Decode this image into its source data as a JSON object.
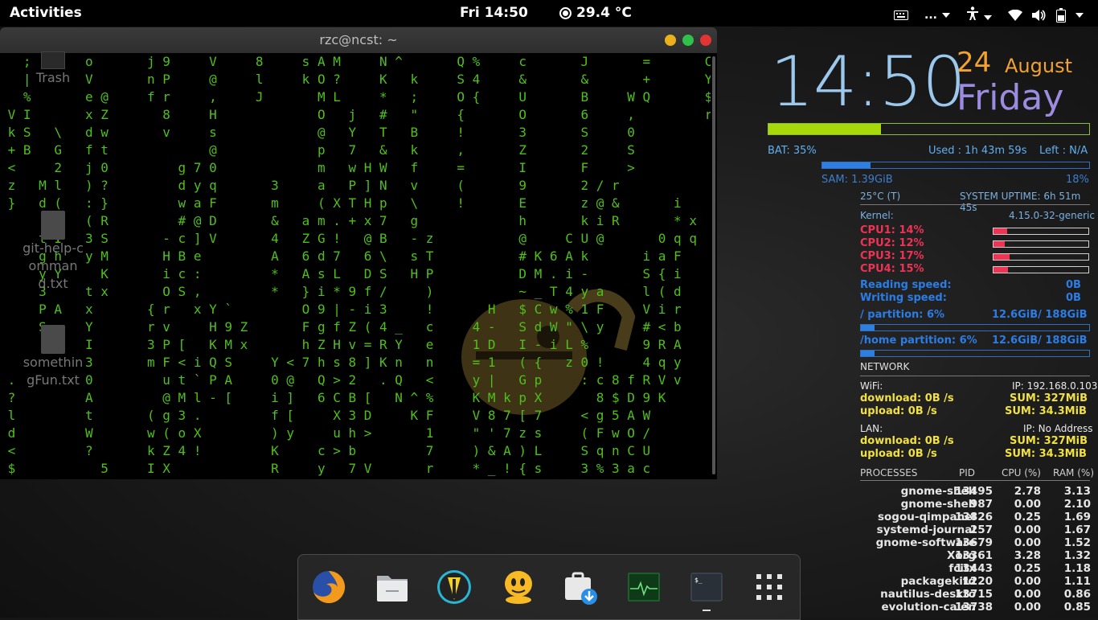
{
  "topbar": {
    "activities": "Activities",
    "clock": "Fri 14:50",
    "weather": "29.4 °C",
    "keyboard_icon": "keyboard-icon",
    "ellipsis": "...",
    "accessibility_icon": "accessibility-icon",
    "system_icons": [
      "wifi-icon",
      "volume-icon",
      "battery-icon"
    ]
  },
  "terminal": {
    "title": "rzc@ncst: ~",
    "buttons": {
      "minimize": "#e9b21c",
      "maximize": "#2fc14a",
      "close": "#e33333"
    },
    "matrix_lines": [
      "   ;       o       j 9     V     8     s A M     N ^       Q %     c       J       =       C",
      "   |       V       n P     @     l     k O ?     K   k     S 4     &       &       +       Y",
      "   %       e @     f r     ,     J       M L     *   ;     O {     U       B     W Q       $",
      " V I       x Z       8     H             O   j   #   \"     {       O       6     ,         r",
      " k S   \\   d w       v     s             @   Y   T   B     !       3       S     0",
      " + B   G   f t             @             p   7   &   k     ,       Z       2     S",
      " <     2   j 0         g 7 0             m   w H W   f     =       I       F     >",
      " z   M l   ) ?         d y q       3     a   P ] N   v     (       9       2 / r",
      " }   d (   : }         w a F       m     ( X T H p   \\     !       E       z @ &       i",
      "     [ <   ( R         # @ D       &   a m . + x 7   g             h       k i R       * x",
      "     t I   3 S       - c ] V       4   Z G !   @ B   - z           @     C U @       0 q q",
      "     g h   y M       H B e         A   6 d 7   6 \\   s T           # K 6 A k       i a F",
      "     y Y     K       i c :         *   A s L   D S   H P           D M . i -       S { i",
      "     3     t x       O S ,         *   } i * 9 f /     )           ~ _ T 4 y a     l ( d",
      "     P A   x       { r   x Y `         O 9 | - i 3     !       H   $ C w % 1 F     V i r",
      "     S     Y       r v     H 9 Z       F g f Z ( 4 _   c     4 -   S d W \" \\ y     # < b",
      "           I       3 P [   K M x       h Z H v = R Y   e     1 D   I - i L %       9 R A",
      "           3       m F < i Q S     Y < 7 h s 8 ] K n   n     = 1   ( {   z 0 !     4 q y",
      " .         0         u t ` P A     0 @   Q > 2   . Q   <     y |   G p     : c 8 f R V v",
      " ?         A         @ M l - [     i ]   6 C B [   N ^ %     K M k p X       8 $ D 9 K",
      " l         t       ( g 3 .         f [     X 3 D     K F     V 8 7 [ 7     < g 5 A W",
      " d         W       w ( o X         ) y     u h >       1     \" ' 7 z s     ( F w O /",
      " <         ?       k Z 4 !         K     c > b         7     ) & A ) L     S q n C U",
      " $           5     I X             R     y   7 V       r     * _ ! { s     3 % 3 a c"
    ]
  },
  "desktop_icons": [
    {
      "label": "Trash",
      "icon": "trash-icon"
    },
    {
      "label": "git-help-command.txt",
      "icon": "text-file-icon"
    },
    {
      "label": "somethingFun.txt",
      "icon": "text-file-icon"
    }
  ],
  "conky": {
    "time": "14:50",
    "day": "24",
    "month": "August",
    "weekday": "Friday",
    "battery_percent": 35,
    "bat_label": "BAT: 35%",
    "used_label": "Used : 1h 43m 59s",
    "left_label": "Left : N/A",
    "sam_label": "SAM: 1.39GiB",
    "sam_percent": "18%",
    "sam_fraction": 0.18,
    "temp": "25°C (T)",
    "uptime": "SYSTEM UPTIME: 6h 51m 45s",
    "kernel_label": "Kernel:",
    "kernel_value": "4.15.0-32-generic",
    "cpus": [
      {
        "label": "CPU1: 14%",
        "fraction": 0.14
      },
      {
        "label": "CPU2: 12%",
        "fraction": 0.12
      },
      {
        "label": "CPU3: 17%",
        "fraction": 0.17
      },
      {
        "label": "CPU4: 15%",
        "fraction": 0.15
      }
    ],
    "reading_label": "Reading speed:",
    "reading_value": "0B",
    "writing_label": "Writing speed:",
    "writing_value": "0B",
    "root_label": "/ partition: 6%",
    "root_value": "12.6GiB/ 188GiB",
    "root_fraction": 0.06,
    "home_label": "/home partition: 6%",
    "home_value": "12.6GiB/ 188GiB",
    "home_fraction": 0.06,
    "network_label": "NETWORK",
    "wifi_label": "WiFi:",
    "wifi_ip": "IP: 192.168.0.103",
    "wifi_download": "download: 0B  /s",
    "wifi_down_sum": "SUM: 327MiB",
    "wifi_upload": "upload: 0B  /s",
    "wifi_up_sum": "SUM: 34.3MiB",
    "lan_label": "LAN:",
    "lan_ip": "IP: No Address",
    "lan_download": "download: 0B  /s",
    "lan_down_sum": "SUM: 327MiB",
    "lan_upload": "upload: 0B  /s",
    "lan_up_sum": "SUM: 34.3MiB",
    "proc_headers": [
      "PROCESSES",
      "PID",
      "CPU (%)",
      "RAM (%)"
    ],
    "processes": [
      [
        "gnome-shell",
        "13495",
        "2.78",
        "3.13"
      ],
      [
        "gnome-shell",
        "987",
        "0.00",
        "2.10"
      ],
      [
        "sogou-qimpanel",
        "13826",
        "0.25",
        "1.69"
      ],
      [
        "systemd-journal",
        "257",
        "0.00",
        "1.67"
      ],
      [
        "gnome-software",
        "13679",
        "0.00",
        "1.52"
      ],
      [
        "Xorg",
        "13361",
        "3.28",
        "1.32"
      ],
      [
        "fcitx",
        "13443",
        "0.25",
        "1.18"
      ],
      [
        "packagekitd",
        "1220",
        "0.00",
        "1.11"
      ],
      [
        "nautilus-deskto",
        "13715",
        "0.00",
        "0.86"
      ],
      [
        "evolution-calen",
        "13738",
        "0.00",
        "0.85"
      ]
    ]
  },
  "dock": {
    "icons": [
      "firefox-icon",
      "files-icon",
      "tor-browser-icon",
      "pidgin-icon",
      "software-install-icon",
      "system-monitor-icon",
      "terminal-icon",
      "app-grid-icon"
    ]
  }
}
